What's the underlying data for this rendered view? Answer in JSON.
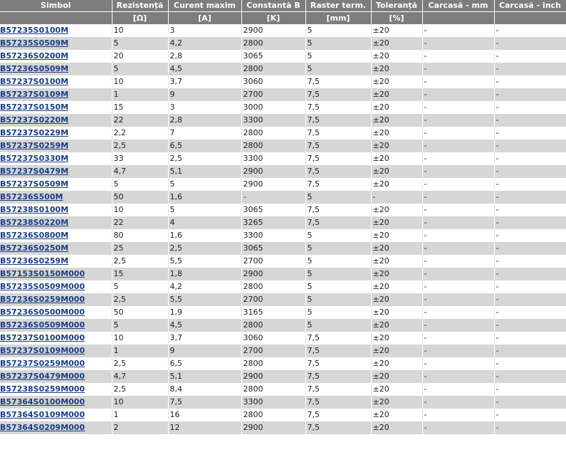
{
  "headers": [
    "Simbol",
    "Rezistență",
    "Curent maxim",
    "Constantă B",
    "Raster term.",
    "Toleranță",
    "Carcasă - mm",
    "Carcasă - inch"
  ],
  "units": [
    "",
    "[Ω]",
    "[A]",
    "[K]",
    "[mm]",
    "[%]",
    "",
    ""
  ],
  "rows": [
    [
      "B57235S0100M",
      "10",
      "3",
      "2900",
      "5",
      "±20",
      "-",
      "-"
    ],
    [
      "B57235S0509M",
      "5",
      "4,2",
      "2800",
      "5",
      "±20",
      "-",
      "-"
    ],
    [
      "B57236S0200M",
      "20",
      "2,8",
      "3065",
      "5",
      "±20",
      "-",
      "-"
    ],
    [
      "B57236S0509M",
      "5",
      "4,5",
      "2800",
      "5",
      "±20",
      "-",
      "-"
    ],
    [
      "B57237S0100M",
      "10",
      "3,7",
      "3060",
      "7,5",
      "±20",
      "-",
      "-"
    ],
    [
      "B57237S0109M",
      "1",
      "9",
      "2700",
      "7,5",
      "±20",
      "-",
      "-"
    ],
    [
      "B57237S0150M",
      "15",
      "3",
      "3000",
      "7,5",
      "±20",
      "-",
      "-"
    ],
    [
      "B57237S0220M",
      "22",
      "2,8",
      "3300",
      "7,5",
      "±20",
      "-",
      "-"
    ],
    [
      "B57237S0229M",
      "2,2",
      "7",
      "2800",
      "7,5",
      "±20",
      "-",
      "-"
    ],
    [
      "B57237S0259M",
      "2,5",
      "6,5",
      "2800",
      "7,5",
      "±20",
      "-",
      "-"
    ],
    [
      "B57237S0330M",
      "33",
      "2,5",
      "3300",
      "7,5",
      "±20",
      "-",
      "-"
    ],
    [
      "B57237S0479M",
      "4,7",
      "5,1",
      "2900",
      "7,5",
      "±20",
      "-",
      "-"
    ],
    [
      "B57237S0509M",
      "5",
      "5",
      "2900",
      "7,5",
      "±20",
      "-",
      "-"
    ],
    [
      "B57236S500M",
      "50",
      "1,6",
      "-",
      "5",
      "-",
      "-",
      "-"
    ],
    [
      "B57238S0100M",
      "10",
      "5",
      "3065",
      "7,5",
      "±20",
      "-",
      "-"
    ],
    [
      "B57238S0220M",
      "22",
      "4",
      "3265",
      "7,5",
      "±20",
      "-",
      "-"
    ],
    [
      "B57236S0800M",
      "80",
      "1,6",
      "3300",
      "5",
      "±20",
      "-",
      "-"
    ],
    [
      "B57236S0250M",
      "25",
      "2,5",
      "3065",
      "5",
      "±20",
      "-",
      "-"
    ],
    [
      "B57236S0259M",
      "2,5",
      "5,5",
      "2700",
      "5",
      "±20",
      "-",
      "-"
    ],
    [
      "B57153S0150M000",
      "15",
      "1,8",
      "2900",
      "5",
      "±20",
      "-",
      "-"
    ],
    [
      "B57235S0509M000",
      "5",
      "4,2",
      "2800",
      "5",
      "±20",
      "-",
      "-"
    ],
    [
      "B57236S0259M000",
      "2,5",
      "5,5",
      "2700",
      "5",
      "±20",
      "-",
      "-"
    ],
    [
      "B57236S0500M000",
      "50",
      "1,9",
      "3165",
      "5",
      "±20",
      "-",
      "-"
    ],
    [
      "B57236S0509M000",
      "5",
      "4,5",
      "2800",
      "5",
      "±20",
      "-",
      "-"
    ],
    [
      "B57237S0100M000",
      "10",
      "3,7",
      "3060",
      "7,5",
      "±20",
      "-",
      "-"
    ],
    [
      "B57237S0109M000",
      "1",
      "9",
      "2700",
      "7,5",
      "±20",
      "-",
      "-"
    ],
    [
      "B57237S0259M000",
      "2,5",
      "6,5",
      "2800",
      "7,5",
      "±20",
      "-",
      "-"
    ],
    [
      "B57237S0479M000",
      "4,7",
      "5,1",
      "2900",
      "7,5",
      "±20",
      "-",
      "-"
    ],
    [
      "B57238S0259M000",
      "2,5",
      "8,4",
      "2800",
      "7,5",
      "±20",
      "-",
      "-"
    ],
    [
      "B57364S0100M000",
      "10",
      "7,5",
      "3300",
      "7,5",
      "±20",
      "-",
      "-"
    ],
    [
      "B57364S0109M000",
      "1",
      "16",
      "2800",
      "7,5",
      "±20",
      "-",
      "-"
    ],
    [
      "B57364S0209M000",
      "2",
      "12",
      "2900",
      "7,5",
      "±20",
      "-",
      "-"
    ]
  ]
}
